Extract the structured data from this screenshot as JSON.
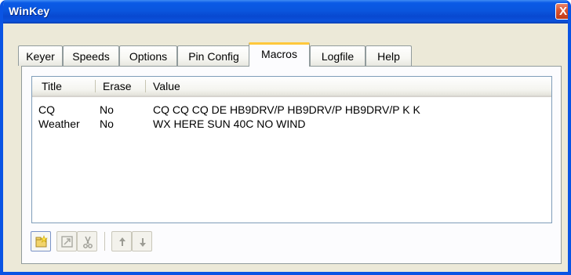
{
  "window": {
    "title": "WinKey",
    "close_glyph": "X"
  },
  "tabs": [
    {
      "label": "Keyer"
    },
    {
      "label": "Speeds"
    },
    {
      "label": "Options"
    },
    {
      "label": "Pin Config"
    },
    {
      "label": "Macros",
      "active": true
    },
    {
      "label": "Logfile"
    },
    {
      "label": "Help"
    }
  ],
  "macros": {
    "columns": {
      "title": "Title",
      "erase": "Erase",
      "value": "Value"
    },
    "rows": [
      {
        "title": "CQ",
        "erase": "No",
        "value": "CQ CQ CQ DE HB9DRV/P HB9DRV/P HB9DRV/P K K"
      },
      {
        "title": "Weather",
        "erase": "No",
        "value": "WX HERE SUN 40C NO WIND"
      }
    ]
  },
  "toolbar": {
    "buttons": [
      {
        "icon": "new-macro-icon",
        "enabled": true
      },
      {
        "icon": "edit-macro-icon",
        "enabled": false
      },
      {
        "icon": "cut-icon",
        "enabled": false
      },
      {
        "icon": "arrow-up-icon",
        "enabled": false
      },
      {
        "icon": "arrow-down-icon",
        "enabled": false
      }
    ]
  },
  "colors": {
    "titlebar": "#0a56de",
    "active_tab_accent": "#ffc83c",
    "dialog_bg": "#ece9d8"
  }
}
